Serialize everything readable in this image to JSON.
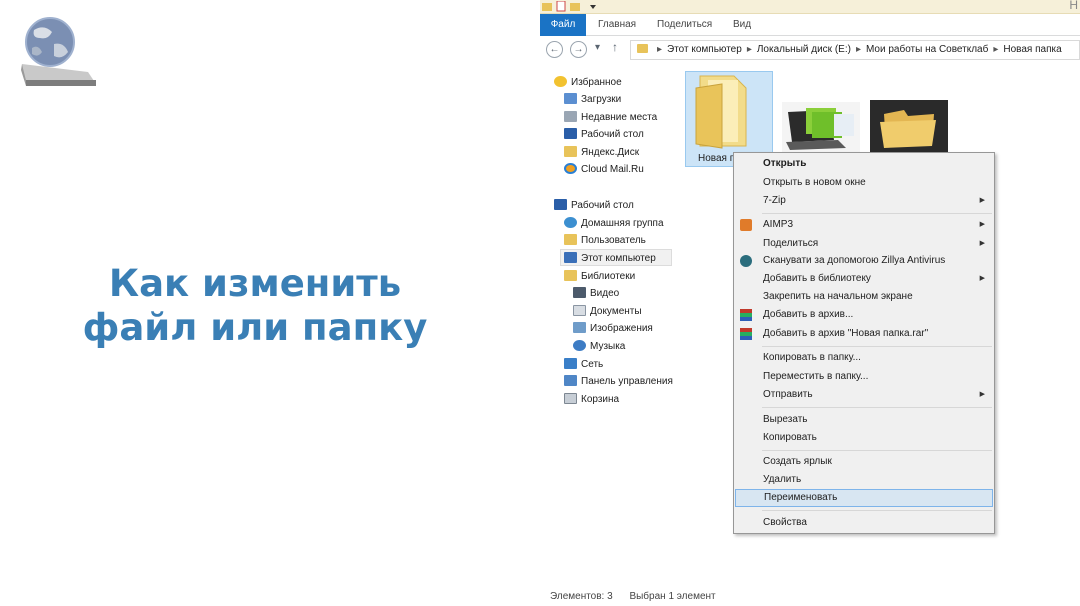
{
  "slide": {
    "title_line1": "Как изменить",
    "title_line2": "файл или папку"
  },
  "ribbon": {
    "tabs": [
      "Файл",
      "Главная",
      "Поделиться",
      "Вид"
    ]
  },
  "address": {
    "crumbs": [
      "Этот компьютер",
      "Локальный диск (E:)",
      "Мои работы на Советклаб",
      "Новая папка"
    ]
  },
  "nav": {
    "favorites": "Избранное",
    "downloads": "Загрузки",
    "recent": "Недавние места",
    "desktop_fav": "Рабочий стол",
    "yandex": "Яндекс.Диск",
    "cloudmail": "Cloud Mail.Ru",
    "desktop": "Рабочий стол",
    "homegroup": "Домашняя группа",
    "user": "Пользователь",
    "thispc": "Этот компьютер",
    "libraries": "Библиотеки",
    "video": "Видео",
    "documents": "Документы",
    "images": "Изображения",
    "music": "Музыка",
    "network": "Сеть",
    "controlpanel": "Панель управления",
    "recycle": "Корзина"
  },
  "content": {
    "selected_label": "Новая п"
  },
  "menu": {
    "open": "Открыть",
    "open_new_window": "Открыть в новом окне",
    "sevenzip": "7-Zip",
    "aimp": "AIMP3",
    "share": "Поделиться",
    "scan": "Сканувати за допомогою Zillya Antivirus",
    "add_library": "Добавить в библиотеку",
    "pin_start": "Закрепить на начальном экране",
    "add_archive": "Добавить в архив...",
    "add_archive_named": "Добавить в архив \"Новая папка.rar\"",
    "copy_to": "Копировать в папку...",
    "move_to": "Переместить в папку...",
    "send_to": "Отправить",
    "cut": "Вырезать",
    "copy": "Копировать",
    "shortcut": "Создать ярлык",
    "delete": "Удалить",
    "rename": "Переименовать",
    "properties": "Свойства"
  },
  "status": {
    "items": "Элементов: 3",
    "selected": "Выбран 1 элемент"
  },
  "colors": {
    "title": "#3a7fb5",
    "file_tab": "#1a73c5",
    "folder": "#e8c35a",
    "highlight": "#d8e6f2"
  }
}
